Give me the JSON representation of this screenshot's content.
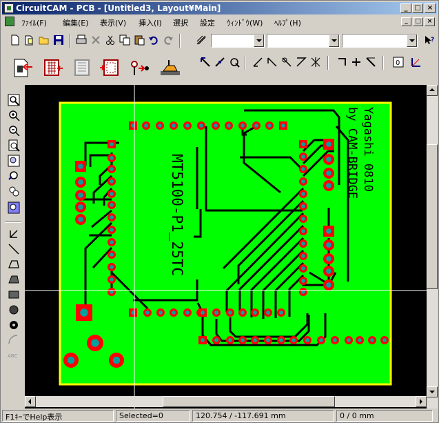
{
  "window": {
    "title": "CircuitCAM - PCB - [Untitled3, Layout¥Main]",
    "caption_buttons": [
      "_",
      "□",
      "×"
    ]
  },
  "menu": {
    "items": [
      {
        "label": "ﾌｧｲﾙ(F)"
      },
      {
        "label": "編集(E)"
      },
      {
        "label": "表示(V)"
      },
      {
        "label": "挿入(I)"
      },
      {
        "label": "選択"
      },
      {
        "label": "設定"
      },
      {
        "label": "ｳｨﾝﾄﾞｳ(W)"
      },
      {
        "label": "ﾍﾙﾌﾟ(H)"
      }
    ],
    "mdi_buttons": [
      "_",
      "□",
      "×"
    ]
  },
  "toolbar": {
    "combos": [
      {
        "value": ""
      },
      {
        "value": ""
      },
      {
        "value": ""
      }
    ]
  },
  "board": {
    "silk_text_left": "MT5100-P1_25TC",
    "silk_text_right_1": "by CAM-BRIDGE",
    "silk_text_right_2": "Yagashi 0810",
    "colors": {
      "board": "#00ff00",
      "outline": "#ffff00",
      "pad": "#ff0000",
      "drill": "#00a0a0",
      "background": "#000000"
    }
  },
  "status": {
    "help": "F1ｷｰでHelp表示",
    "selected": "Selected=0",
    "coords": "120.754 / -117.691 mm",
    "delta": "0 / 0 mm"
  }
}
